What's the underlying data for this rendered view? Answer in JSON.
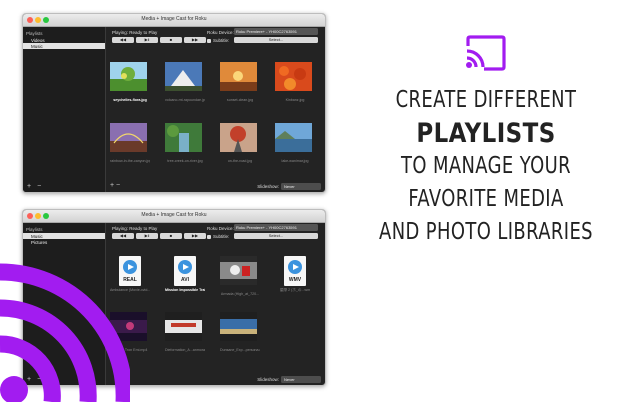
{
  "window_title": "Media + Image Cast for Roku",
  "sidebar": {
    "header": "Playlists",
    "window1_items": [
      "Videos",
      "Music"
    ],
    "window2_items": [
      "Music",
      "Pictures"
    ],
    "add_label": "+",
    "remove_label": "−"
  },
  "player": {
    "status_label": "Playing:",
    "status_value": "Ready to Play",
    "roku_label": "Roku Device:",
    "roku_device": "Roku Premiere+ - YH00C2763591",
    "subtitle_label": "Subtitle:",
    "subtitle_button": "Select...",
    "controls": [
      "◀◀",
      "▶‖",
      "■",
      "▶▶"
    ]
  },
  "slideshow": {
    "label": "Slideshow:",
    "value": "Never"
  },
  "window1_items": [
    {
      "name": "seychelles-flora.jpg",
      "selected": true
    },
    {
      "name": "volcano-mt-rapoundae.jpg",
      "selected": false
    },
    {
      "name": "sunset-clean.jpg",
      "selected": false
    },
    {
      "name": "Kinbanz.jpg",
      "selected": false
    },
    {
      "name": "rainbow-in-the-canyon.jpg",
      "selected": false
    },
    {
      "name": "tree-creek-on-river.jpg",
      "selected": false
    },
    {
      "name": "on-the-road.jpg",
      "selected": false
    },
    {
      "name": "lake-wanimar.jpg",
      "selected": false
    }
  ],
  "window2_items": [
    {
      "name": "Ambulance (Movie-xvid...",
      "selected": false,
      "ext": "REAL"
    },
    {
      "name": "Mission Impossible Trailer.avi",
      "selected": true,
      "ext": "AVI"
    },
    {
      "name": "Armada (High_at_720...",
      "selected": false,
      "ext": ""
    },
    {
      "name": "星際 2 (ホ_の...wm",
      "selected": false,
      "ext": "WMV"
    },
    {
      "name": "Blagar: Tron Emi.mp4",
      "selected": false,
      "ext": ""
    },
    {
      "name": "Dieformation_A...anmora.mp4",
      "selected": false,
      "ext": ""
    },
    {
      "name": "Dunsane_Exp...persona.mp4",
      "selected": false,
      "ext": ""
    }
  ],
  "tagline": [
    "CREATE DIFFERENT",
    "PLAYLISTS",
    "TO MANAGE YOUR",
    "FAVORITE MEDIA",
    "AND PHOTO LIBRARIES"
  ],
  "colors": {
    "accent": "#a21cf0",
    "window_bg": "#232323",
    "sidebar_bg": "#1d1d1d"
  }
}
